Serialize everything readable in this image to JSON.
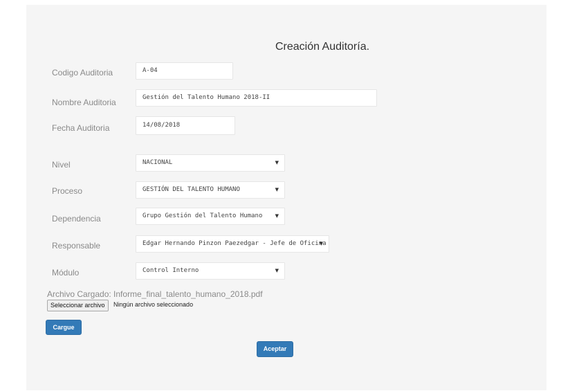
{
  "form": {
    "title": "Creación Auditoría.",
    "codigo": {
      "label": "Codigo Auditoria",
      "value": "A-04"
    },
    "nombre": {
      "label": "Nombre Auditoria",
      "value": "Gestión del Talento Humano 2018-II"
    },
    "fecha": {
      "label": "Fecha Auditoria",
      "value": "14/08/2018"
    },
    "nivel": {
      "label": "Nivel",
      "value": "NACIONAL"
    },
    "proceso": {
      "label": "Proceso",
      "value": "GESTIÓN DEL TALENTO HUMANO"
    },
    "dependencia": {
      "label": "Dependencia",
      "value": "Grupo Gestión del Talento Humano"
    },
    "responsable": {
      "label": "Responsable",
      "value": "Edgar Hernando Pinzon Paezedgar - Jefe de Oficina"
    },
    "modulo": {
      "label": "Módulo",
      "value": "Control Interno"
    },
    "archivo": {
      "label": "Archivo Cargado: Informe_final_talento_humano_2018.pdf",
      "button_label": "Seleccionar archivo",
      "status": "Ningún archivo seleccionado"
    },
    "cargue_label": "Cargue",
    "aceptar_label": "Aceptar",
    "dropdown_arrow": "▼"
  },
  "colors": {
    "panel_bg": "#f5f5f5",
    "primary_button": "#337ab7",
    "label_text": "#8a8a8a"
  }
}
